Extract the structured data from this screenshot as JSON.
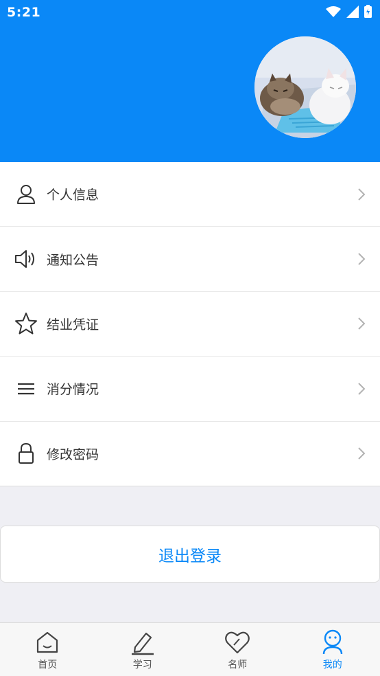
{
  "status_bar": {
    "time": "5:21"
  },
  "menu": {
    "items": [
      {
        "label": "个人信息",
        "icon": "person-icon"
      },
      {
        "label": "通知公告",
        "icon": "speaker-icon"
      },
      {
        "label": "结业凭证",
        "icon": "star-icon"
      },
      {
        "label": "消分情况",
        "icon": "menu-lines-icon"
      },
      {
        "label": "修改密码",
        "icon": "lock-icon"
      }
    ]
  },
  "logout": {
    "label": "退出登录"
  },
  "tabbar": {
    "tabs": [
      {
        "label": "首页",
        "icon": "home-icon"
      },
      {
        "label": "学习",
        "icon": "pencil-icon"
      },
      {
        "label": "名师",
        "icon": "heart-icon"
      },
      {
        "label": "我的",
        "icon": "profile-icon",
        "active": true
      }
    ]
  },
  "colors": {
    "accent": "#0a88f7",
    "background": "#efeff4"
  }
}
